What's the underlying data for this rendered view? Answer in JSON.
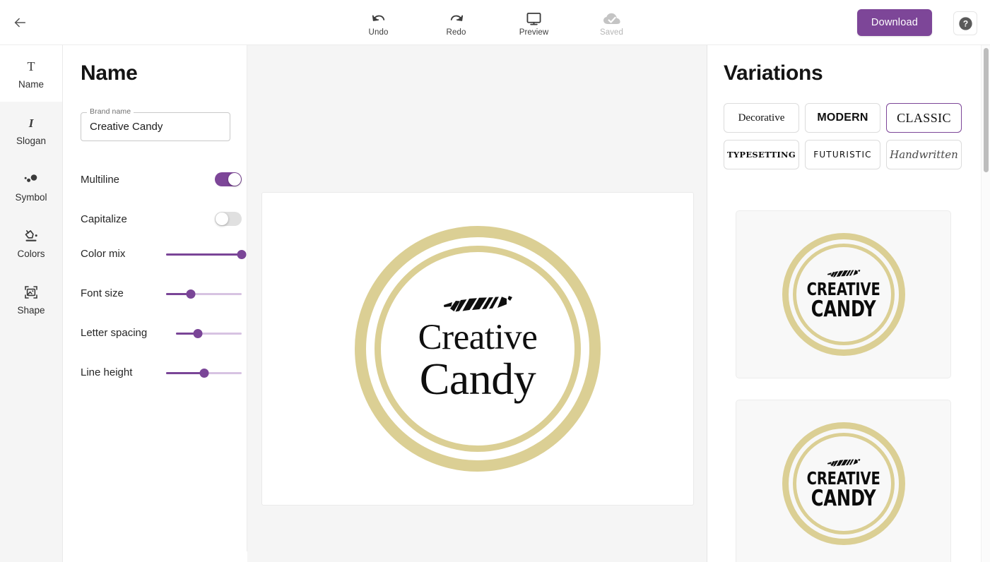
{
  "topbar": {
    "back_icon": "arrow-left-icon",
    "tools": [
      {
        "label": "Undo",
        "icon": "undo-icon",
        "disabled": false
      },
      {
        "label": "Redo",
        "icon": "redo-icon",
        "disabled": false
      },
      {
        "label": "Preview",
        "icon": "monitor-icon",
        "disabled": false
      },
      {
        "label": "Saved",
        "icon": "cloud-check-icon",
        "disabled": true
      }
    ],
    "download_label": "Download",
    "help_label": "?",
    "accent_color": "#7d4698"
  },
  "rail": {
    "items": [
      {
        "label": "Name",
        "icon": "text-t-icon",
        "active": true
      },
      {
        "label": "Slogan",
        "icon": "italic-i-icon",
        "active": false
      },
      {
        "label": "Symbol",
        "icon": "dots-symbol-icon",
        "active": false
      },
      {
        "label": "Colors",
        "icon": "paint-bucket-icon",
        "active": false
      },
      {
        "label": "Shape",
        "icon": "image-frame-icon",
        "active": false
      }
    ]
  },
  "panel": {
    "title": "Name",
    "brand_field": {
      "label": "Brand name",
      "value": "Creative Candy",
      "placeholder": "Brand name"
    },
    "toggles": [
      {
        "label": "Multiline",
        "on": true
      },
      {
        "label": "Capitalize",
        "on": false
      }
    ],
    "sliders": [
      {
        "label": "Color mix",
        "percent": 100
      },
      {
        "label": "Font size",
        "percent": 33
      },
      {
        "label": "Letter spacing",
        "percent": 33
      },
      {
        "label": "Line height",
        "percent": 50
      }
    ]
  },
  "canvas": {
    "logo": {
      "symbol": "candy-icon",
      "line1": "Creative",
      "line2": "Candy",
      "ring_color": "#dbcf94",
      "text_color": "#0f0f0f"
    }
  },
  "variations": {
    "title": "Variations",
    "styles": [
      {
        "label": "Decorative",
        "key": "s-decorative",
        "selected": false
      },
      {
        "label": "MODERN",
        "key": "s-modern",
        "selected": false
      },
      {
        "label": "CLASSIC",
        "key": "s-classic",
        "selected": true
      },
      {
        "label": "TYPESETTING",
        "key": "s-typesetting",
        "selected": false
      },
      {
        "label": "FUTURISTIC",
        "key": "s-futuristic",
        "selected": false
      },
      {
        "label": "Handwritten",
        "key": "s-handwritten",
        "selected": false
      }
    ],
    "cards": [
      {
        "line1": "CREATIVE",
        "line2": "CANDY",
        "symbol": "candy-icon",
        "ring_color": "#dbcf94"
      },
      {
        "line1": "CREATIVE",
        "line2": "CANDY",
        "symbol": "candy-icon",
        "ring_color": "#dbcf94"
      }
    ]
  }
}
